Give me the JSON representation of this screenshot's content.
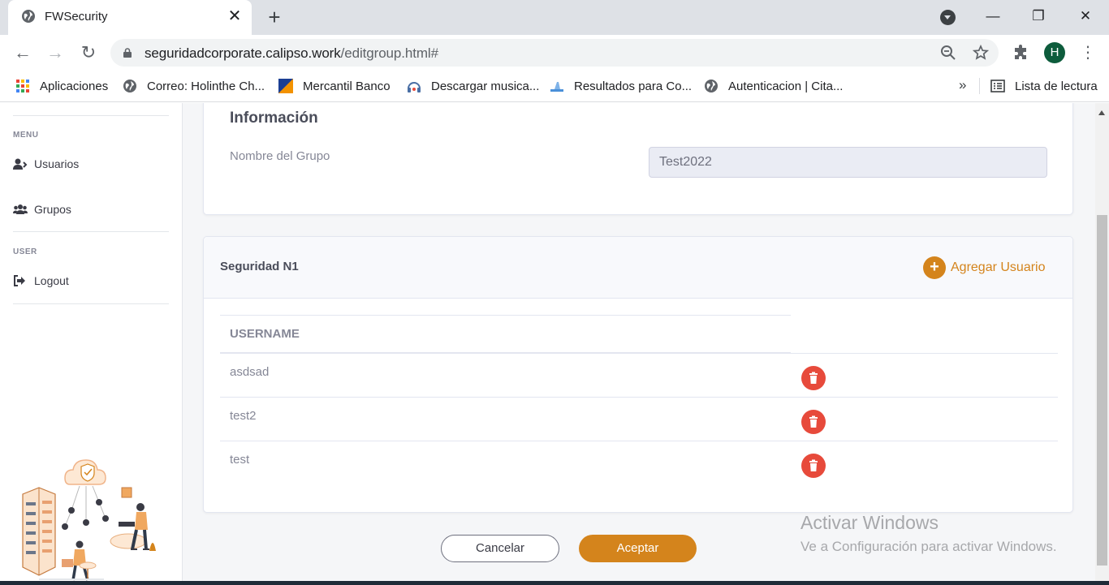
{
  "browser": {
    "tab_title": "FWSecurity",
    "tab_close": "✕",
    "new_tab": "+",
    "url_host": "seguridadcorporate.calipso.work",
    "url_path": "/editgroup.html#",
    "avatar_letter": "H",
    "window_controls": {
      "minimize": "—",
      "maximize": "❐",
      "close": "✕"
    },
    "icons": [
      "globe-icon",
      "lock-icon",
      "zoom-icon",
      "star-icon",
      "puzzle-icon",
      "menu-icon"
    ]
  },
  "bookmarks": {
    "items": [
      {
        "label": "Aplicaciones",
        "icon": "apps-grid-icon"
      },
      {
        "label": "Correo: Holinthe Ch...",
        "icon": "globe-icon"
      },
      {
        "label": "Mercantil Banco",
        "icon": "mercantil-icon"
      },
      {
        "label": "Descargar musica...",
        "icon": "music-icon"
      },
      {
        "label": "Resultados para Co...",
        "icon": "search-result-icon"
      },
      {
        "label": "Autenticacion | Cita...",
        "icon": "globe-icon"
      }
    ],
    "more": "»",
    "reading_list": "Lista de lectura"
  },
  "sidebar": {
    "menu_heading": "MENU",
    "user_heading": "USER",
    "items": [
      {
        "label": "Usuarios",
        "icon": "user-icon"
      },
      {
        "label": "Grupos",
        "icon": "users-icon"
      },
      {
        "label": "Logout",
        "icon": "logout-icon"
      }
    ]
  },
  "info": {
    "title": "Información",
    "group_name_label": "Nombre del Grupo",
    "group_name_value": "Test2022"
  },
  "group_card": {
    "title": "Seguridad N1",
    "add_user_label": "Agregar Usuario",
    "column_username": "USERNAME",
    "rows": [
      "asdsad",
      "test2",
      "test"
    ]
  },
  "actions": {
    "cancel": "Cancelar",
    "accept": "Aceptar"
  },
  "watermark": {
    "line1": "Activar Windows",
    "line2": "Ve a Configuración para activar Windows."
  },
  "colors": {
    "accent": "#d4841c",
    "danger": "#e74a3b",
    "avatar": "#0d5c3c"
  }
}
